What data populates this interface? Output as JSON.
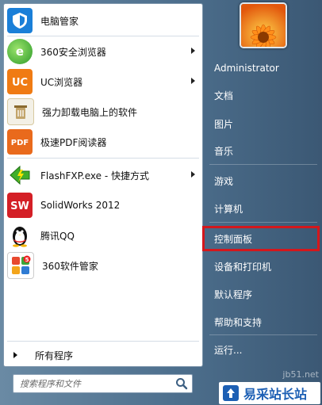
{
  "programs": [
    {
      "label": "电脑管家",
      "icon": "tencent-pc-manager-icon",
      "has_submenu": false
    },
    {
      "label": "360安全浏览器",
      "icon": "360-browser-icon",
      "has_submenu": true
    },
    {
      "label": "UC浏览器",
      "icon": "uc-browser-icon",
      "has_submenu": true
    },
    {
      "label": "强力卸载电脑上的软件",
      "icon": "uninstaller-icon",
      "has_submenu": false
    },
    {
      "label": "极速PDF阅读器",
      "icon": "pdf-reader-icon",
      "has_submenu": false
    },
    {
      "label": "FlashFXP.exe - 快捷方式",
      "icon": "flashfxp-icon",
      "has_submenu": true
    },
    {
      "label": "SolidWorks 2012",
      "icon": "solidworks-icon",
      "has_submenu": false
    },
    {
      "label": "腾讯QQ",
      "icon": "qq-penguin-icon",
      "has_submenu": false
    },
    {
      "label": "360软件管家",
      "icon": "360-software-manager-icon",
      "has_submenu": false
    }
  ],
  "all_programs_label": "所有程序",
  "search": {
    "placeholder": "搜索程序和文件"
  },
  "right_menu": [
    {
      "label": "Administrator"
    },
    {
      "label": "文档"
    },
    {
      "label": "图片"
    },
    {
      "label": "音乐"
    },
    {
      "label": "游戏"
    },
    {
      "label": "计算机"
    },
    {
      "label": "控制面板",
      "highlighted": true
    },
    {
      "label": "设备和打印机"
    },
    {
      "label": "默认程序"
    },
    {
      "label": "帮助和支持"
    },
    {
      "label": "运行..."
    }
  ],
  "watermark": {
    "text": "易采站长站",
    "sub": "jb51.net"
  },
  "colors": {
    "highlight_border": "#d4171c",
    "menu_bg": "#4d6f8d"
  }
}
